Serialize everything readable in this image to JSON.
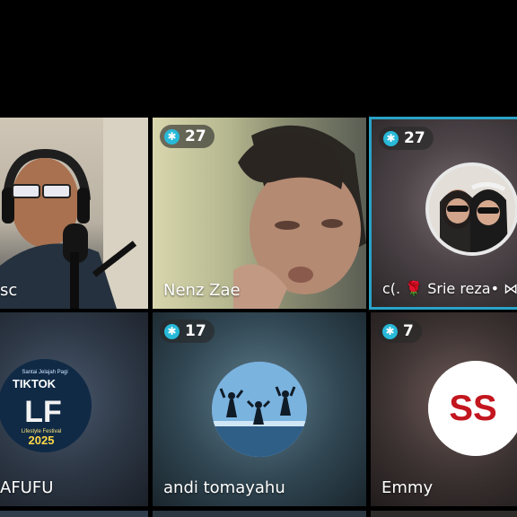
{
  "tiles": [
    {
      "name": "sc"
    },
    {
      "count": "27",
      "name": "Nenz Zae"
    },
    {
      "count": "27",
      "name": "ᴄ(. 🌹 Srie reza• ⋈"
    },
    {
      "name": "AFUFU",
      "avatar_text": {
        "top": "Santai Jelajah Pagi",
        "brand": "TIKTOK",
        "letters": "LF",
        "year": "2025",
        "sub": "Lifestyle Festival"
      }
    },
    {
      "count": "17",
      "name": "andi tomayahu"
    },
    {
      "count": "7",
      "name": "Emmy",
      "avatar_text": {
        "letters": "SS"
      }
    }
  ],
  "colors": {
    "badge_icon": "#28b9d8",
    "active_border": "#2aa3c7"
  },
  "icons": {
    "badge": "snowflake-icon"
  }
}
